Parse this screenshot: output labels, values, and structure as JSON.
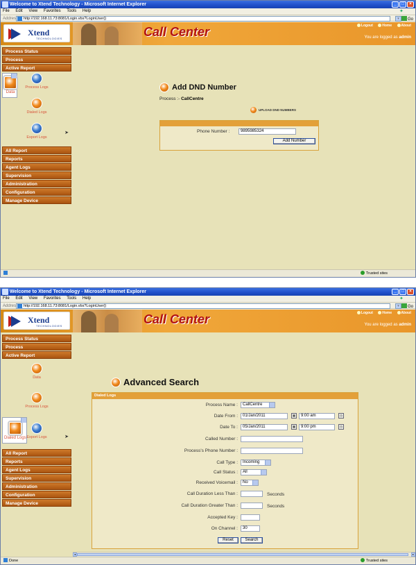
{
  "window1": {
    "title": "Welcome to Xtend Technology - Microsoft Internet Explorer",
    "menu": [
      "File",
      "Edit",
      "View",
      "Favorites",
      "Tools",
      "Help"
    ],
    "address_label": "Address",
    "address": "http://192.168.11.73:8081/Login.vbs?LoginUser()",
    "go_label": "Go",
    "brand": {
      "logo_word": "Xtend",
      "logo_sub": "TECHNOLOGIES",
      "title": "Call Center"
    },
    "toplinks": [
      "Logout",
      "Home",
      "About"
    ],
    "logged_in_prefix": "You are logged as",
    "logged_in_user": "admin",
    "sidebar_top": [
      "Process Status",
      "Process",
      "Active Report"
    ],
    "sidebar_subitems": [
      "Data",
      "Process Logs",
      "Dialed Logs",
      "Export Logs"
    ],
    "sidebar_bottom": [
      "All Report",
      "Reports",
      "Agent Logs",
      "Supervision",
      "Administration",
      "Configuration",
      "Manage Device"
    ],
    "heading": "Add DND Number",
    "process_label": "Process :-",
    "process_value": "CallCentre",
    "upload_label": "UPLOAD DND NUMBERS",
    "phone_label": "Phone Number :",
    "phone_value": "9895985324",
    "add_button": "Add Number",
    "status_trusted": "Trusted sites",
    "status_left": ""
  },
  "window2": {
    "title": "Welcome to Xtend Technology - Microsoft Internet Explorer",
    "menu": [
      "File",
      "Edit",
      "View",
      "Favorites",
      "Tools",
      "Help"
    ],
    "address_label": "Address",
    "address": "http://192.168.11.73:8081/Login.vbs?LoginUser()",
    "go_label": "Go",
    "brand": {
      "logo_word": "Xtend",
      "logo_sub": "TECHNOLOGIES",
      "title": "Call Center"
    },
    "toplinks": [
      "Logout",
      "Home",
      "About"
    ],
    "logged_in_prefix": "You are logged as",
    "logged_in_user": "admin",
    "sidebar_top": [
      "Process Status",
      "Process",
      "Active Report"
    ],
    "sidebar_subitems": [
      "Data",
      "Process Logs",
      "Dialed Logs",
      "Export Logs"
    ],
    "sidebar_bottom": [
      "All Report",
      "Reports",
      "Agent Logs",
      "Supervision",
      "Administration",
      "Configuration",
      "Manage Device"
    ],
    "heading": "Advanced Search",
    "box_title": "Dialed Logs",
    "fields": {
      "process_name": {
        "label": "Process Name :",
        "value": "CallCentre"
      },
      "date_from": {
        "label": "Date From :",
        "date": "01/Jan/2011",
        "time": "9:00 am"
      },
      "date_to": {
        "label": "Date To :",
        "date": "05/Jan/2011",
        "time": "9:00 pm"
      },
      "called_number": {
        "label": "Called Number :",
        "value": ""
      },
      "process_phone": {
        "label": "Process's Phone Number :",
        "value": ""
      },
      "call_type": {
        "label": "Call Type :",
        "value": "Incoming"
      },
      "call_status": {
        "label": "Call Status :",
        "value": "All"
      },
      "voicemail": {
        "label": "Received Voicemail :",
        "value": "No"
      },
      "dur_less": {
        "label": "Call Duration Less Than :",
        "value": "",
        "unit": "Seconds"
      },
      "dur_greater": {
        "label": "Call Duration Greater Than :",
        "value": "",
        "unit": "Seconds"
      },
      "accepted_key": {
        "label": "Accepted Key :",
        "value": ""
      },
      "on_channel": {
        "label": "On Channel :",
        "value": "30"
      }
    },
    "reset_button": "Reset",
    "search_button": "Search",
    "status_left": "Done",
    "status_trusted": "Trusted sites"
  }
}
